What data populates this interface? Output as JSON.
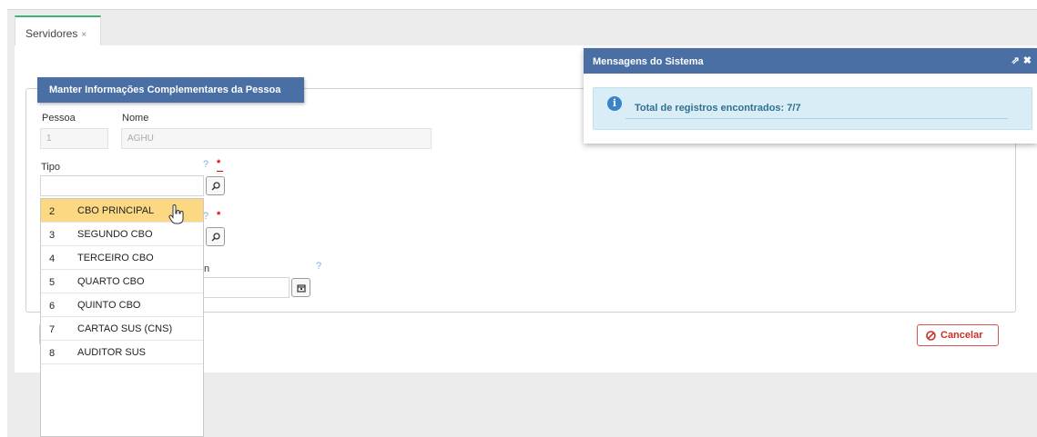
{
  "tabs": [
    {
      "label": "Servidores",
      "close": "×"
    }
  ],
  "form": {
    "legend": "Manter Informações Complementares da Pessoa",
    "pessoa_label": "Pessoa",
    "pessoa_value": "1",
    "nome_label": "Nome",
    "nome_value": "AGHU",
    "tipo_label": "Tipo",
    "tipo_value": "",
    "help_mark": "?",
    "required_mark": "*",
    "partial_label": "n"
  },
  "dropdown": {
    "items": [
      {
        "code": "2",
        "label": "CBO PRINCIPAL",
        "selected": true
      },
      {
        "code": "3",
        "label": "SEGUNDO CBO"
      },
      {
        "code": "4",
        "label": "TERCEIRO CBO"
      },
      {
        "code": "5",
        "label": "QUARTO CBO"
      },
      {
        "code": "6",
        "label": "QUINTO CBO"
      },
      {
        "code": "7",
        "label": "CARTAO SUS (CNS)"
      },
      {
        "code": "8",
        "label": "AUDITOR SUS"
      }
    ]
  },
  "buttons": {
    "cancel": "Cancelar"
  },
  "messages": {
    "title": "Mensagens do Sistema",
    "text": "Total de registros encontrados: 7/7"
  },
  "colors": {
    "header": "#4a6fa5",
    "selected": "#fdd882",
    "accent": "#3cb371",
    "danger": "#d9534f"
  }
}
